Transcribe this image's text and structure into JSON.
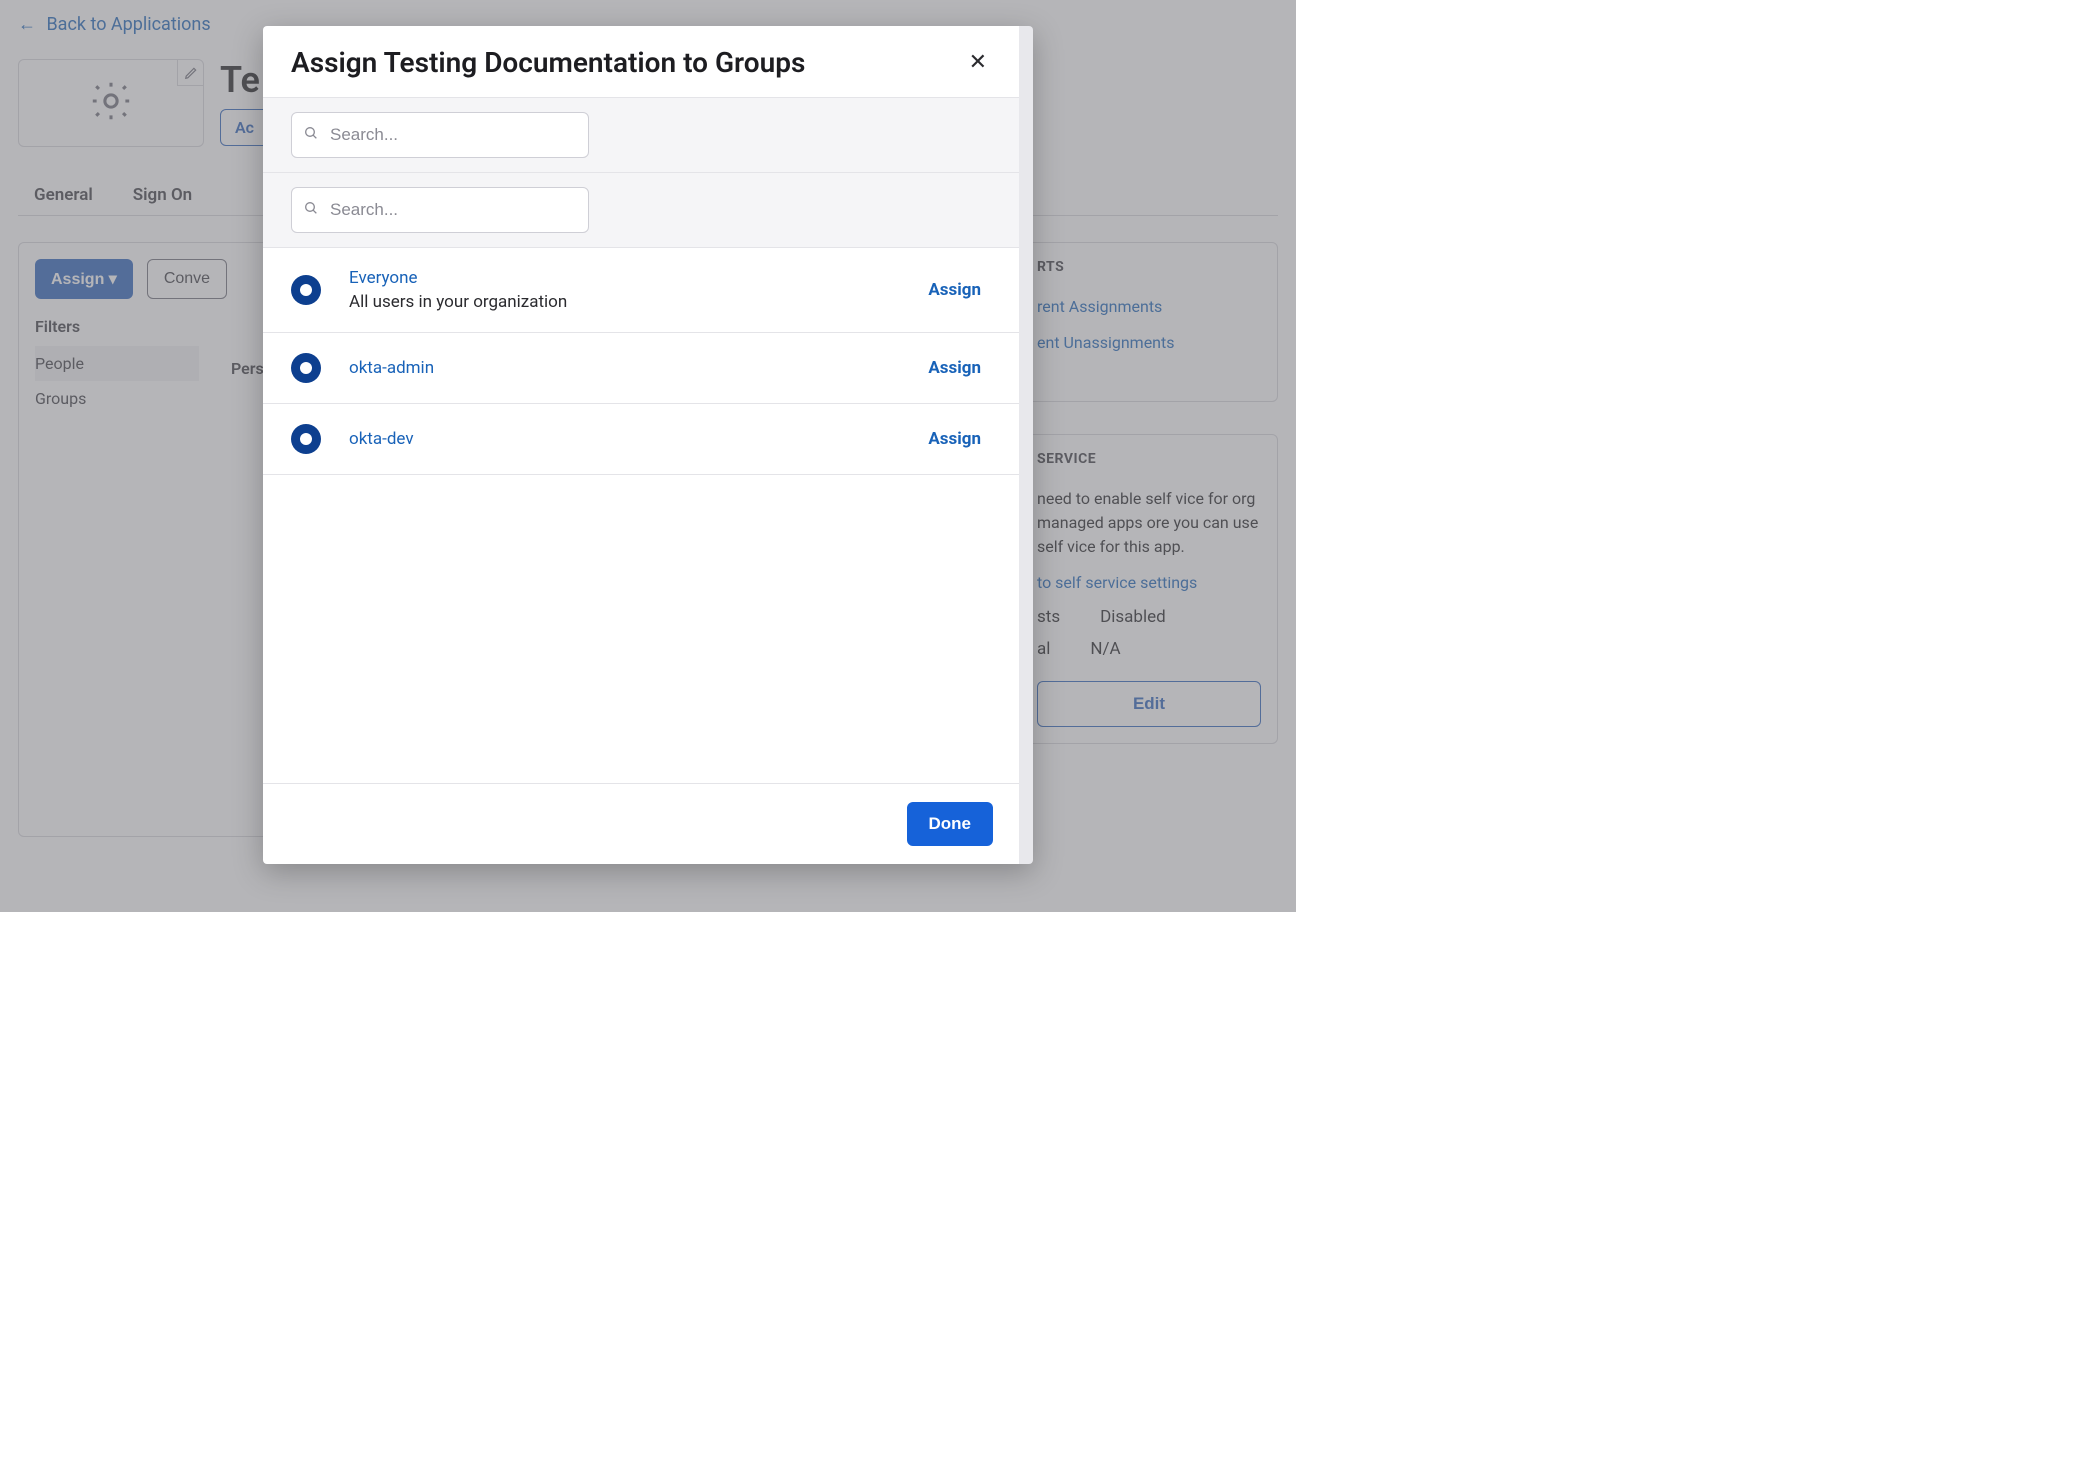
{
  "back_link": "Back to Applications",
  "app_title": "Te",
  "active_btn": "Ac",
  "tabs": {
    "general": "General",
    "signon": "Sign On"
  },
  "main": {
    "assign_btn": "Assign ▾",
    "convert_btn": "Conve",
    "filters_label": "Filters",
    "filter_people": "People",
    "filter_groups": "Groups",
    "col_person": "Pers"
  },
  "reports": {
    "title": "RTS",
    "link1": "rent Assignments",
    "link2": "ent Unassignments"
  },
  "selfservice": {
    "title": "SERVICE",
    "body": "need to enable self vice for org managed apps ore you can use self vice for this app.",
    "link": "to self service settings",
    "req_label": "sts",
    "req_value": "Disabled",
    "app_label": "al",
    "app_value": "N/A",
    "edit": "Edit"
  },
  "modal": {
    "title": "Assign Testing Documentation to Groups",
    "search_placeholder": "Search...",
    "groups": [
      {
        "name": "Everyone",
        "desc": "All users in your organization",
        "assign": "Assign"
      },
      {
        "name": "okta-admin",
        "desc": "",
        "assign": "Assign"
      },
      {
        "name": "okta-dev",
        "desc": "",
        "assign": "Assign"
      }
    ],
    "done": "Done"
  }
}
